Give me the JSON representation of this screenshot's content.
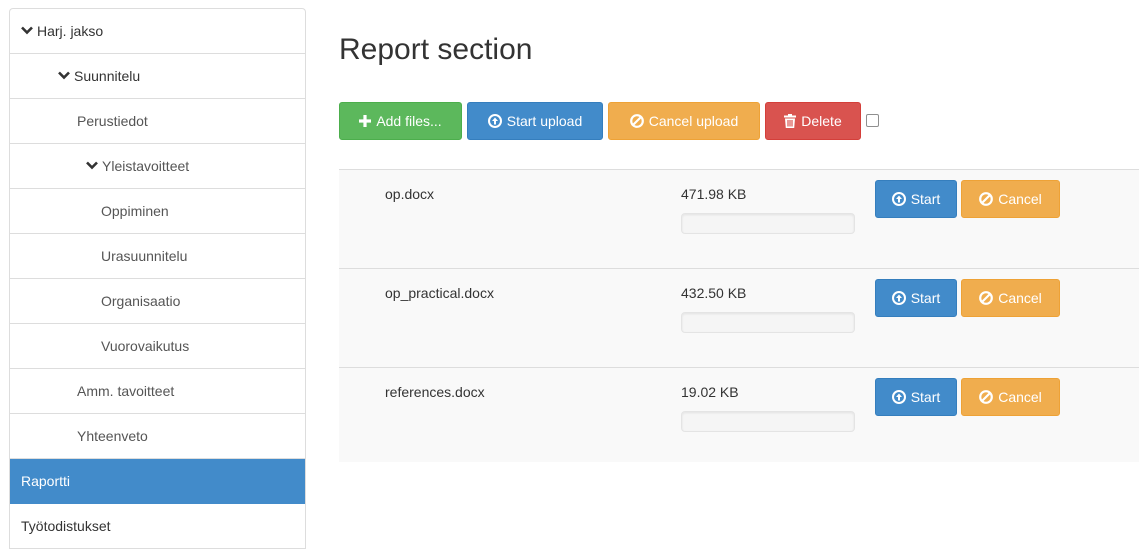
{
  "sidebar": {
    "items": [
      {
        "label": "Harj. jakso",
        "level": 0,
        "expanded": true
      },
      {
        "label": "Suunnitelu",
        "level": 1,
        "expanded": true
      },
      {
        "label": "Perustiedot",
        "level": 1
      },
      {
        "label": "Yleistavoitteet",
        "level": 1,
        "expanded": true
      },
      {
        "label": "Oppiminen",
        "level": 2
      },
      {
        "label": "Urasuunnitelu",
        "level": 2
      },
      {
        "label": "Organisaatio",
        "level": 2
      },
      {
        "label": "Vuorovaikutus",
        "level": 2
      },
      {
        "label": "Amm. tavoitteet",
        "level": 1
      },
      {
        "label": "Yhteenveto",
        "level": 1
      },
      {
        "label": "Raportti",
        "level": 0,
        "active": true
      },
      {
        "label": "Työtodistukset",
        "level": 0
      }
    ]
  },
  "main": {
    "title": "Report section"
  },
  "toolbar": {
    "add_label": "Add files...",
    "add_icon": "plus-icon",
    "start_label": "Start upload",
    "start_icon": "circle-arrow-up-icon",
    "cancel_label": "Cancel upload",
    "cancel_icon": "ban-circle-icon",
    "delete_label": "Delete",
    "delete_icon": "trash-icon",
    "select_all_checked": false
  },
  "files": [
    {
      "name": "op.docx",
      "size": "471.98 KB",
      "progress": 0,
      "start_label": "Start",
      "cancel_label": "Cancel"
    },
    {
      "name": "op_practical.docx",
      "size": "432.50 KB",
      "progress": 0,
      "start_label": "Start",
      "cancel_label": "Cancel"
    },
    {
      "name": "references.docx",
      "size": "19.02 KB",
      "progress": 0,
      "start_label": "Start",
      "cancel_label": "Cancel"
    }
  ],
  "colors": {
    "accent": "#428bca",
    "success": "#5cb85c",
    "warning": "#f0ad4e",
    "danger": "#d9534f"
  }
}
